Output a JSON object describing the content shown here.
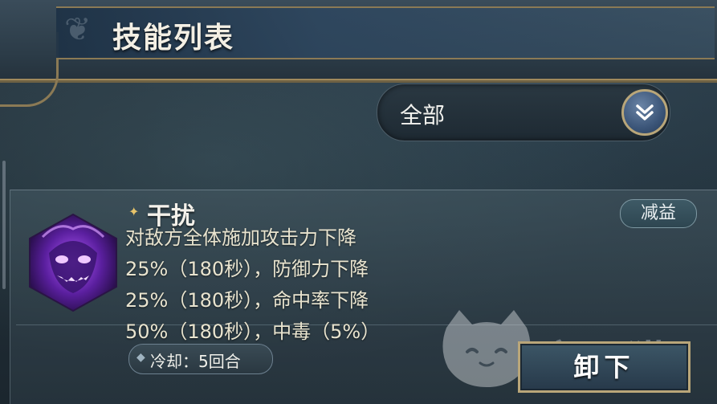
{
  "header": {
    "title": "技能列表"
  },
  "filter": {
    "selected": "全部",
    "icon": "double-chevron-down-icon"
  },
  "skill": {
    "name": "干扰",
    "type_badge": "减益",
    "icon": "purple-demon-face-icon",
    "description_lines": [
      "对敌方全体施加攻击力下降",
      "25%（180秒），防御力下降",
      "25%（180秒），命中率下降",
      "50%（180秒），中毒（5%）"
    ],
    "cooldown": "冷却：5回合",
    "action_label": "卸下"
  },
  "watermark": {
    "text": "交易猫"
  },
  "colors": {
    "gold_border": "#b9a679",
    "title_text": "#f3efe4",
    "description_text": "#e9e4cf",
    "skill_mark": "#e8c46a"
  }
}
